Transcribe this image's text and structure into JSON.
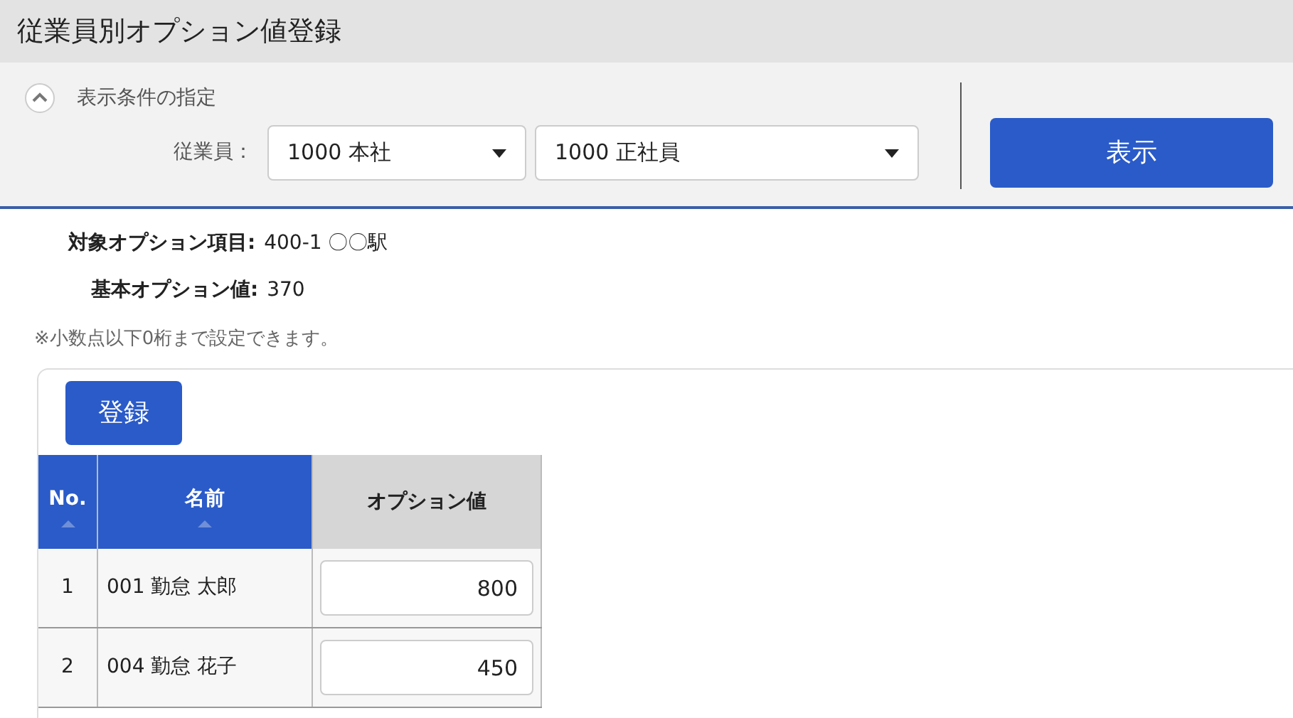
{
  "window": {
    "title": "従業員別オプション値登録"
  },
  "filter": {
    "heading": "表示条件の指定",
    "expanded": true,
    "label": "従業員：",
    "selects": [
      "1000 本社",
      "1000 正社員"
    ],
    "button": "表示"
  },
  "info": [
    {
      "label": "対象オプション項目:",
      "value": "400-1 〇〇駅"
    },
    {
      "label": "基本オプション値:",
      "value": "370"
    }
  ],
  "note": "※小数点以下0桁まで設定できます。",
  "register_button": "登録",
  "table": {
    "columns": [
      {
        "label": "No.",
        "sortable": true
      },
      {
        "label": "名前",
        "sortable": true
      },
      {
        "label": "オプション値",
        "sortable": false
      }
    ],
    "rows": [
      {
        "no": "1",
        "name": "001 勤怠 太郎",
        "value": "800"
      },
      {
        "no": "2",
        "name": "004 勤怠 花子",
        "value": "450"
      }
    ]
  }
}
